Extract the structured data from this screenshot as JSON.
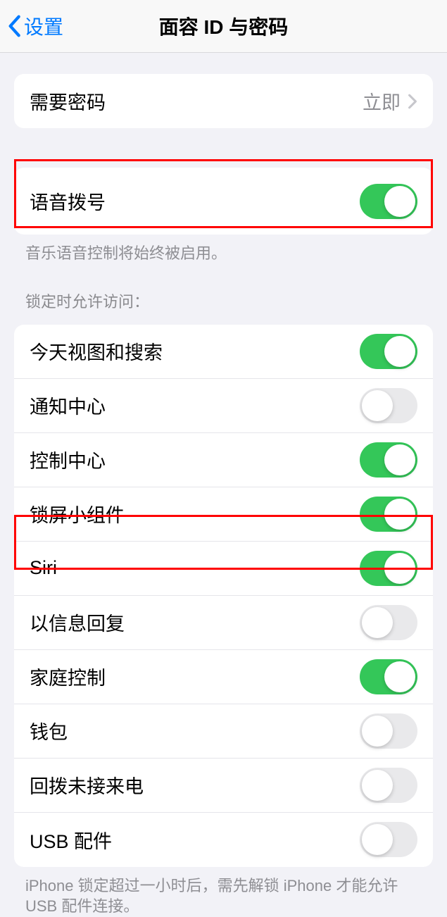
{
  "header": {
    "back_label": "设置",
    "title": "面容 ID 与密码"
  },
  "require_passcode": {
    "label": "需要密码",
    "value": "立即"
  },
  "voice_dial": {
    "label": "语音拨号",
    "footer": "音乐语音控制将始终被启用。",
    "state": "on"
  },
  "lock_access": {
    "header": "锁定时允许访问：",
    "items": [
      {
        "label": "今天视图和搜索",
        "state": "on"
      },
      {
        "label": "通知中心",
        "state": "off"
      },
      {
        "label": "控制中心",
        "state": "on"
      },
      {
        "label": "锁屏小组件",
        "state": "on"
      },
      {
        "label": "Siri",
        "state": "on"
      },
      {
        "label": "以信息回复",
        "state": "off"
      },
      {
        "label": "家庭控制",
        "state": "on"
      },
      {
        "label": "钱包",
        "state": "off"
      },
      {
        "label": "回拨未接来电",
        "state": "off"
      },
      {
        "label": "USB 配件",
        "state": "off"
      }
    ],
    "footer": "iPhone 锁定超过一小时后，需先解锁 iPhone 才能允许 USB 配件连接。"
  }
}
